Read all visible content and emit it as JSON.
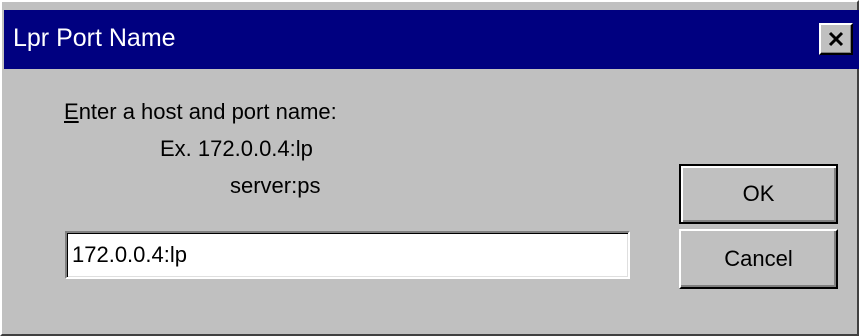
{
  "window": {
    "title": "Lpr Port Name"
  },
  "titlebar": {
    "color": "#000080",
    "close_icon": "close-x-icon"
  },
  "form": {
    "prompt_label": "Enter a host and port name:",
    "example_line_1": "Ex. 172.0.0.4:lp",
    "example_line_2": "server:ps",
    "host_value": "172.0.0.4:lp"
  },
  "buttons": {
    "ok_label": "OK",
    "cancel_label": "Cancel"
  }
}
